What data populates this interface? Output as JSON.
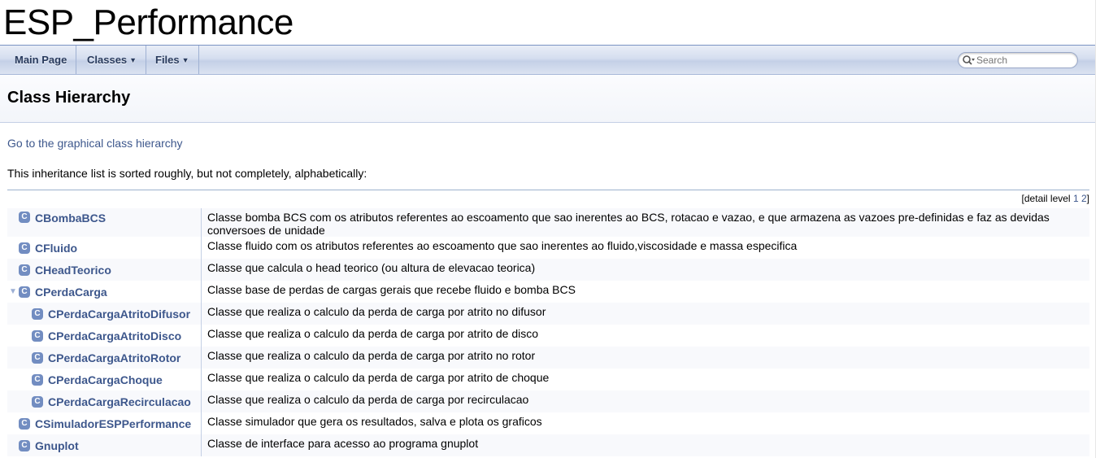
{
  "project": {
    "title": "ESP_Performance"
  },
  "navbar": {
    "main_page": "Main Page",
    "classes": "Classes",
    "files": "Files",
    "search_placeholder": "Search"
  },
  "header": {
    "title": "Class Hierarchy"
  },
  "content": {
    "graph_link": "Go to the graphical class hierarchy",
    "intro": "This inheritance list is sorted roughly, but not completely, alphabetically:",
    "detail_level_label": "[detail level",
    "detail_level_1": "1",
    "detail_level_2": "2",
    "detail_level_close": "]"
  },
  "classes": [
    {
      "name": "CBombaBCS",
      "indent": 0,
      "expandable": false,
      "desc": "Classe bomba BCS com os atributos referentes ao escoamento que sao inerentes ao BCS, rotacao e vazao, e que armazena as vazoes pre-definidas e faz as devidas conversoes de unidade"
    },
    {
      "name": "CFluido",
      "indent": 0,
      "expandable": false,
      "desc": "Classe fluido com os atributos referentes ao escoamento que sao inerentes ao fluido,viscosidade e massa especifica"
    },
    {
      "name": "CHeadTeorico",
      "indent": 0,
      "expandable": false,
      "desc": "Classe que calcula o head teorico (ou altura de elevacao teorica)"
    },
    {
      "name": "CPerdaCarga",
      "indent": 0,
      "expandable": true,
      "desc": "Classe base de perdas de cargas gerais que recebe fluido e bomba BCS"
    },
    {
      "name": "CPerdaCargaAtritoDifusor",
      "indent": 1,
      "expandable": false,
      "desc": "Classe que realiza o calculo da perda de carga por atrito no difusor"
    },
    {
      "name": "CPerdaCargaAtritoDisco",
      "indent": 1,
      "expandable": false,
      "desc": "Classe que realiza o calculo da perda de carga por atrito de disco"
    },
    {
      "name": "CPerdaCargaAtritoRotor",
      "indent": 1,
      "expandable": false,
      "desc": "Classe que realiza o calculo da perda de carga por atrito no rotor"
    },
    {
      "name": "CPerdaCargaChoque",
      "indent": 1,
      "expandable": false,
      "desc": "Classe que realiza o calculo da perda de carga por atrito de choque"
    },
    {
      "name": "CPerdaCargaRecirculacao",
      "indent": 1,
      "expandable": false,
      "desc": "Classe que realiza o calculo da perda de carga por recirculacao"
    },
    {
      "name": "CSimuladorESPPerformance",
      "indent": 0,
      "expandable": false,
      "desc": "Classe simulador que gera os resultados, salva e plota os graficos"
    },
    {
      "name": "Gnuplot",
      "indent": 0,
      "expandable": false,
      "desc": "Classe de interface para acesso ao programa gnuplot"
    }
  ],
  "icons": {
    "class_icon_letter": "C",
    "expand_arrow": "▼"
  },
  "colors": {
    "link": "#3d578c",
    "icon_bg": "#728dc1",
    "nav_text": "#283a5d"
  }
}
